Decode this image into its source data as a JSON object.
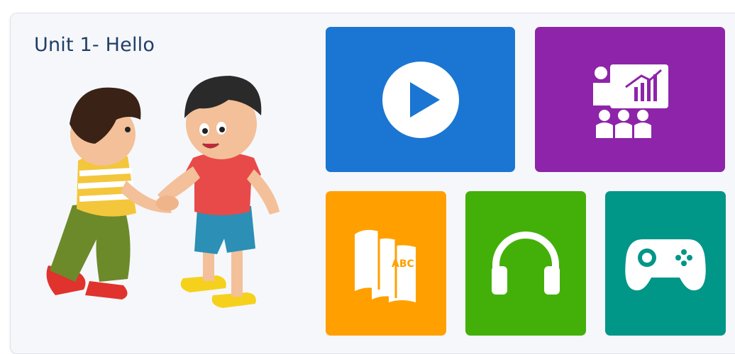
{
  "unit": {
    "title": "Unit 1- Hello"
  },
  "illustration": {
    "name": "two-boys-shaking-hands"
  },
  "tiles": [
    {
      "id": "video",
      "icon": "play-icon",
      "color": "#1a76d2"
    },
    {
      "id": "lesson",
      "icon": "presentation-icon",
      "color": "#8e24aa"
    },
    {
      "id": "vocabulary",
      "icon": "abc-books-icon",
      "color": "#ffa000",
      "icon_text": "ABC"
    },
    {
      "id": "listening",
      "icon": "headphones-icon",
      "color": "#43b00a"
    },
    {
      "id": "game",
      "icon": "gamepad-icon",
      "color": "#009688"
    }
  ]
}
